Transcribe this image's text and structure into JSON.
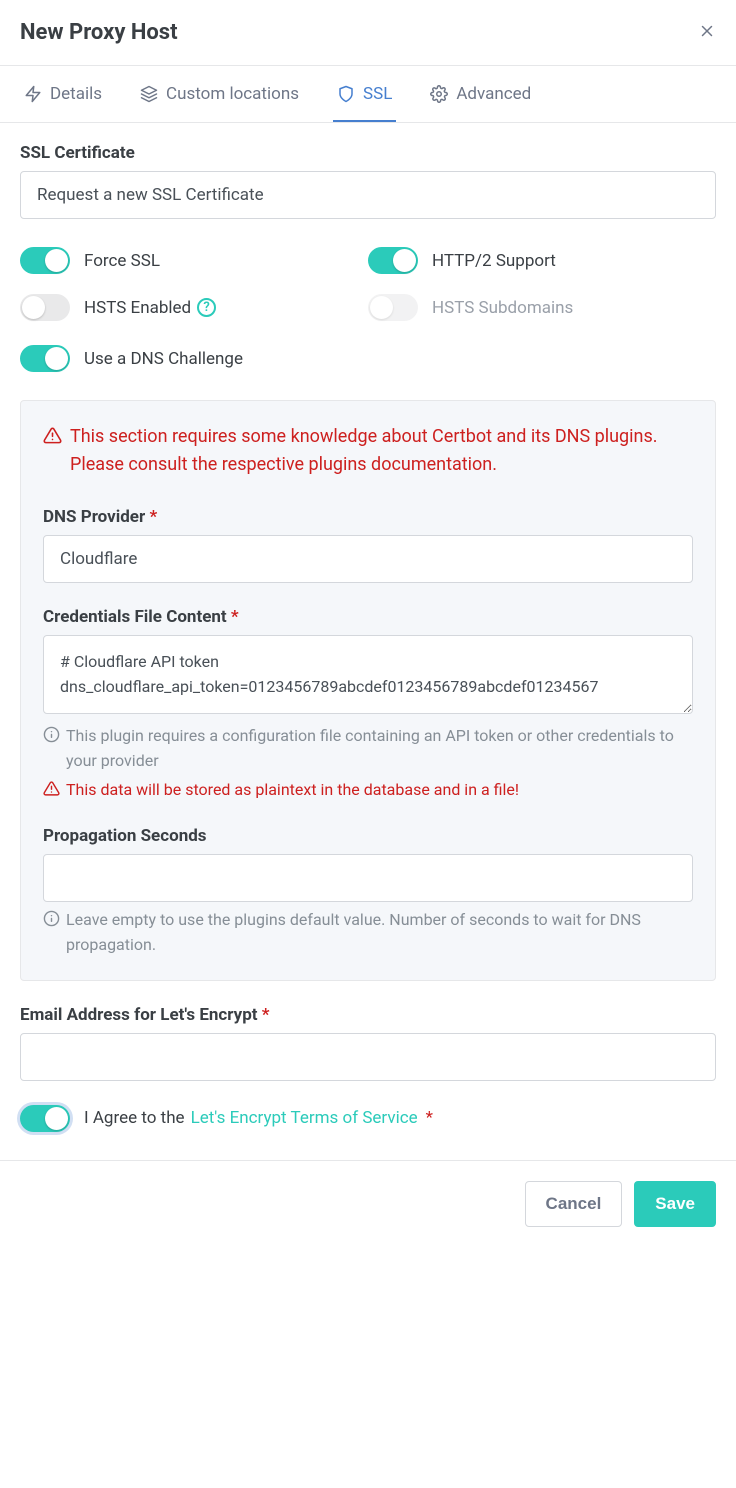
{
  "header": {
    "title": "New Proxy Host"
  },
  "tabs": {
    "details": "Details",
    "custom_locations": "Custom locations",
    "ssl": "SSL",
    "advanced": "Advanced"
  },
  "ssl": {
    "cert_label": "SSL Certificate",
    "cert_value": "Request a new SSL Certificate",
    "toggles": {
      "force_ssl": "Force SSL",
      "http2": "HTTP/2 Support",
      "hsts": "HSTS Enabled",
      "hsts_sub": "HSTS Subdomains",
      "dns_challenge": "Use a DNS Challenge"
    },
    "dns": {
      "warning": "This section requires some knowledge about Certbot and its DNS plugins. Please consult the respective plugins documentation.",
      "provider_label": "DNS Provider",
      "provider_value": "Cloudflare",
      "creds_label": "Credentials File Content",
      "creds_value": "# Cloudflare API token\ndns_cloudflare_api_token=0123456789abcdef0123456789abcdef01234567",
      "creds_help": "This plugin requires a configuration file containing an API token or other credentials to your provider",
      "creds_warn": "This data will be stored as plaintext in the database and in a file!",
      "propagation_label": "Propagation Seconds",
      "propagation_value": "",
      "propagation_help": "Leave empty to use the plugins default value. Number of seconds to wait for DNS propagation."
    },
    "email_label": "Email Address for Let's Encrypt",
    "agree_pre": "I Agree to the ",
    "agree_link": "Let's Encrypt Terms of Service"
  },
  "footer": {
    "cancel": "Cancel",
    "save": "Save"
  }
}
